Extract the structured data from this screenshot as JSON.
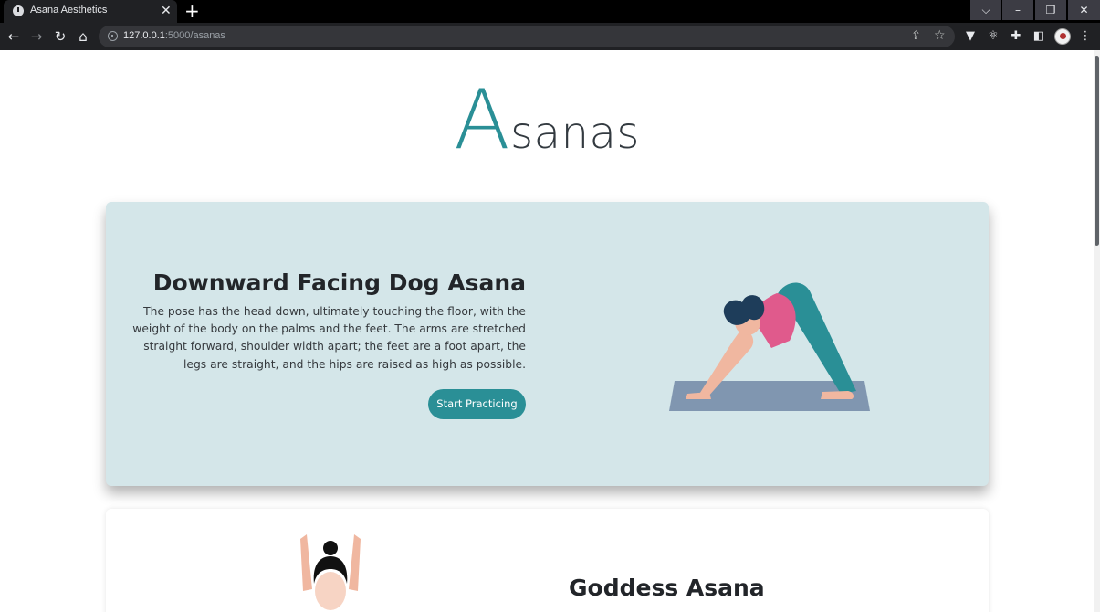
{
  "browser": {
    "tab_title": "Asana Aesthetics",
    "tab_close": "✕",
    "new_tab": "+",
    "url_host": "127.0.0.1",
    "url_path": ":5000/asanas"
  },
  "page": {
    "title_initial": "A",
    "title_rest": "sanas"
  },
  "cards": [
    {
      "title": "Downward Facing Dog Asana",
      "description": "The pose has the head down, ultimately touching the floor, with the weight of the body on the palms and the feet. The arms are stretched straight forward, shoulder width apart; the feet are a foot apart, the legs are straight, and the hips are raised as high as possible.",
      "button_label": "Start Practicing",
      "background": "#d4e6e9"
    },
    {
      "title": "Goddess Asana",
      "background": "#ffffff"
    }
  ],
  "colors": {
    "accent": "#2a8f96",
    "mat": "#8096b0",
    "top": "#e05a8c",
    "hair": "#1e3d5a",
    "skin": "#f0b7a0"
  },
  "icons": [
    "back-icon",
    "forward-icon",
    "reload-icon",
    "home-icon",
    "info-icon",
    "share-icon",
    "star-icon",
    "extension-icons",
    "profile-avatar"
  ]
}
